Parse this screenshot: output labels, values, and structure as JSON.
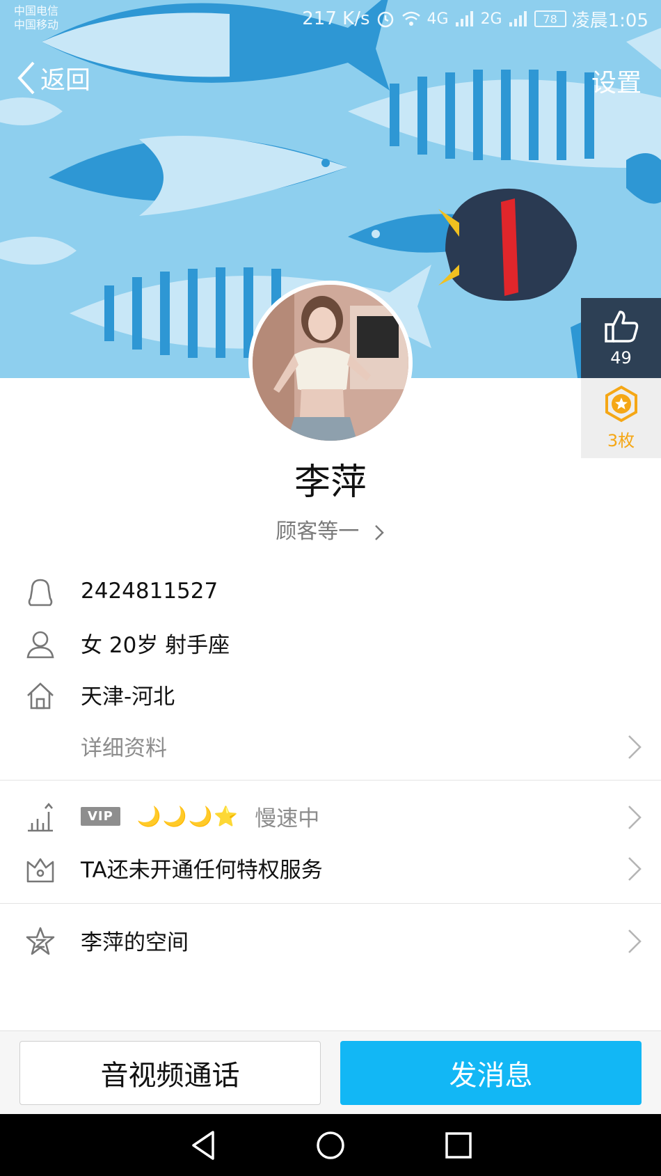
{
  "status_bar": {
    "carrier_1": "中国电信",
    "carrier_2": "中国移动",
    "net_speed": "217 K/s",
    "net_4g": "4G",
    "net_2g": "2G",
    "battery": "78",
    "time": "凌晨1:05"
  },
  "nav": {
    "back_label": "返回",
    "settings_label": "设置"
  },
  "side_badges": {
    "likes": "49",
    "medals": "3枚"
  },
  "profile": {
    "name": "李萍",
    "level_text": "顾客等一",
    "qq_number": "2424811527",
    "gender_age_sign": "女  20岁  射手座",
    "hometown": "天津-河北",
    "detail_link": "详细资料"
  },
  "vip": {
    "badge": "VIP",
    "level_icons": "🌙🌙🌙⭐",
    "status": "慢速中",
    "privilege_text": "TA还未开通任何特权服务"
  },
  "space": {
    "label": "李萍的空间"
  },
  "actions": {
    "call_label": "音视频通话",
    "message_label": "发消息"
  },
  "colors": {
    "accent": "#12b7f5",
    "cover_bg": "#8ecfee",
    "medal": "#f5a716"
  }
}
